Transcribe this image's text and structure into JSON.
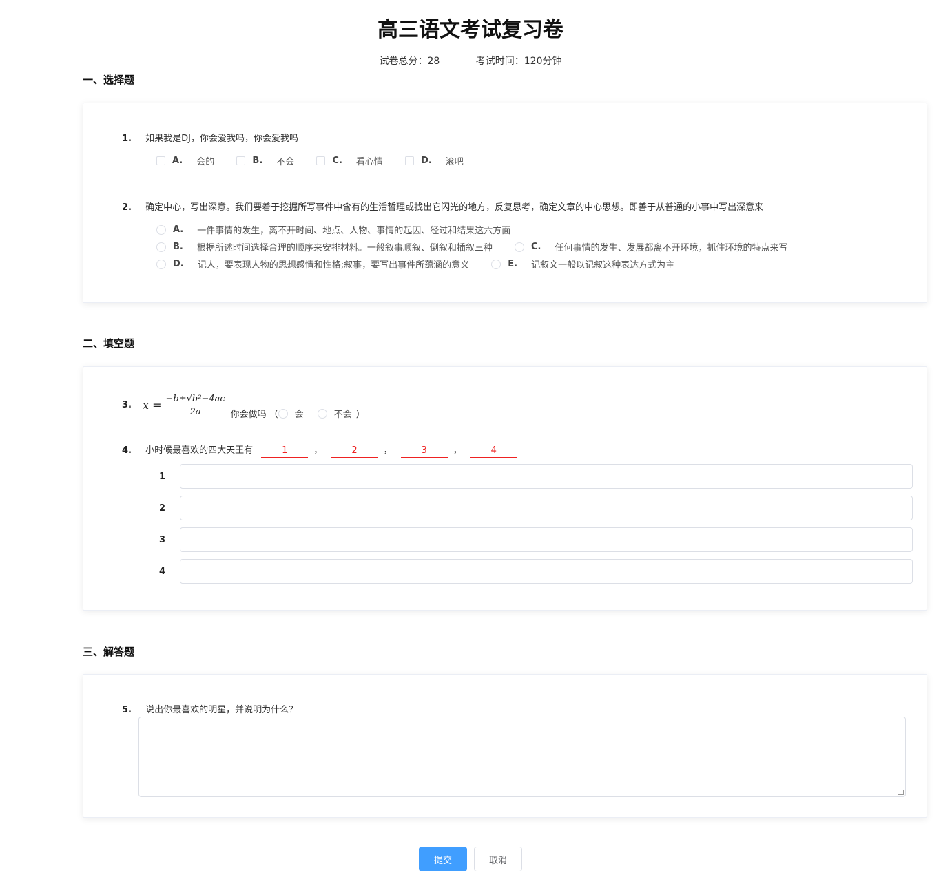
{
  "header": {
    "title": "高三语文考试复习卷",
    "total_score": "试卷总分：28",
    "exam_time": "考试时间：120分钟"
  },
  "sections": {
    "choice_title": "一、选择题",
    "fill_title": "二、填空题",
    "answer_title": "三、解答题"
  },
  "q1": {
    "num": "1.",
    "text": "如果我是DJ，你会爱我吗，你会爱我吗",
    "options": [
      {
        "letter": "A.",
        "text": "会的"
      },
      {
        "letter": "B.",
        "text": "不会"
      },
      {
        "letter": "C.",
        "text": "看心情"
      },
      {
        "letter": "D.",
        "text": "滚吧"
      }
    ]
  },
  "q2": {
    "num": "2.",
    "text": "确定中心，写出深意。我们要着于挖掘所写事件中含有的生活哲理或找出它闪光的地方，反复思考，确定文章的中心思想。即善于从普通的小事中写出深意来",
    "options": [
      {
        "letter": "A.",
        "text": "一件事情的发生，离不开时间、地点、人物、事情的起因、经过和结果这六方面"
      },
      {
        "letter": "B.",
        "text": "根据所述时间选择合理的顺序来安排材料。一般叙事顺叙、倒叙和插叙三种"
      },
      {
        "letter": "C.",
        "text": "任何事情的发生、发展都离不开环境，抓住环境的特点来写"
      },
      {
        "letter": "D.",
        "text": "记人，要表现人物的思想感情和性格;叙事，要写出事件所蕴涵的意义"
      },
      {
        "letter": "E.",
        "text": "记叙文一般以记叙这种表达方式为主"
      }
    ]
  },
  "q3": {
    "num": "3.",
    "formula_lhs": "x =",
    "formula_num": "−b±√b²−4ac",
    "formula_den": "2a",
    "prompt": "你会做吗",
    "paren_open": "（",
    "paren_close": "）",
    "opt_yes": "会",
    "opt_no": "不会"
  },
  "q4": {
    "num": "4.",
    "text": "小时候最喜欢的四大天王有",
    "blanks": [
      "1",
      "2",
      "3",
      "4"
    ],
    "sep": "，",
    "inputs": [
      {
        "label": "1",
        "value": ""
      },
      {
        "label": "2",
        "value": ""
      },
      {
        "label": "3",
        "value": ""
      },
      {
        "label": "4",
        "value": ""
      }
    ]
  },
  "q5": {
    "num": "5.",
    "text": "说出你最喜欢的明星，并说明为什么？",
    "value": ""
  },
  "buttons": {
    "submit": "提交",
    "cancel": "取消"
  },
  "colors": {
    "primary": "#409eff",
    "blank": "#ee2222",
    "border": "#dcdfe6"
  }
}
